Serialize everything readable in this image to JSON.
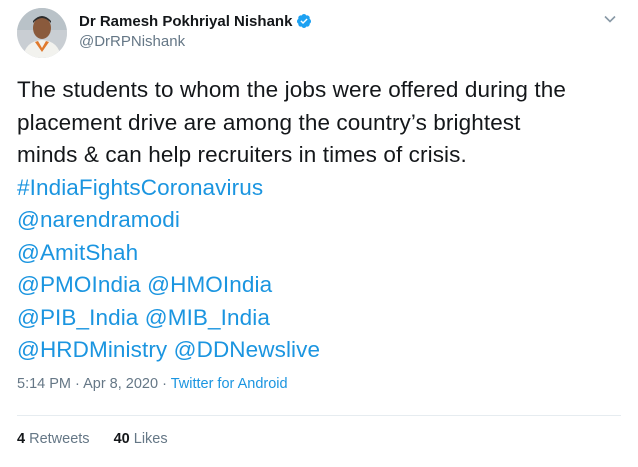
{
  "author": {
    "display_name": "Dr Ramesh Pokhriyal Nishank",
    "handle": "@DrRPNishank",
    "verified": true
  },
  "tweet": {
    "text_line_1": "The students to whom the jobs were offered during the",
    "text_line_2": "placement drive are among the country’s brightest",
    "text_line_3": "minds & can help recruiters in times of crisis.",
    "hashtag": "#IndiaFightsCoronavirus",
    "mention_1": "@narendramodi",
    "mention_2": "@AmitShah",
    "mention_3": "@PMOIndia",
    "mention_4": "@HMOIndia",
    "mention_5": "@PIB_India",
    "mention_6": "@MIB_India",
    "mention_7": "@HRDMinistry",
    "mention_8": "@DDNewslive"
  },
  "meta": {
    "time": "5:14 PM",
    "separator_1": " · ",
    "date": "Apr 8, 2020",
    "separator_2": " · ",
    "source": "Twitter for Android"
  },
  "stats": {
    "retweets_count": "4",
    "retweets_label": "Retweets",
    "likes_count": "40",
    "likes_label": "Likes"
  },
  "colors": {
    "link": "#1b95e0",
    "verified_badge": "#1da1f2",
    "secondary_text": "#657786"
  },
  "icons": {
    "verified": "verified-badge-icon",
    "more": "chevron-down-icon"
  }
}
